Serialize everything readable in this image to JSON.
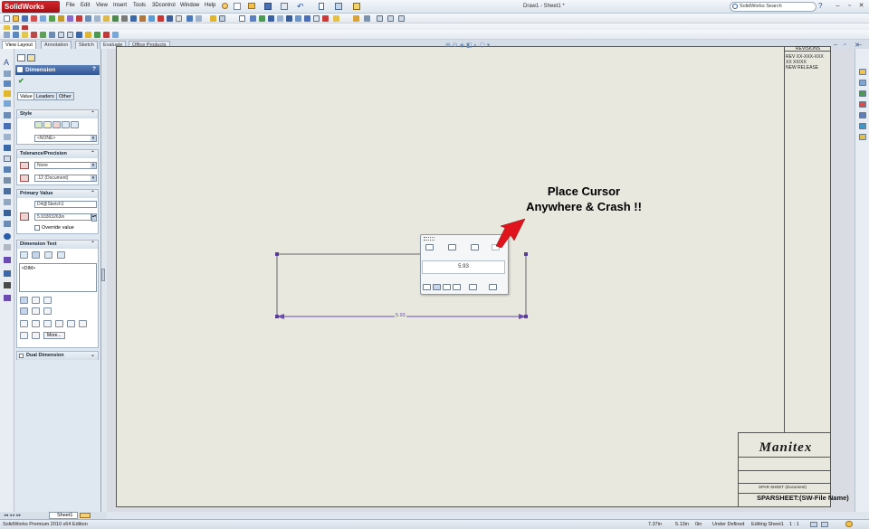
{
  "app": {
    "name": "SolidWorks",
    "document_title": "Draw1 - Sheet1 *",
    "menu": [
      "File",
      "Edit",
      "View",
      "Insert",
      "Tools",
      "3Dcontrol",
      "Window",
      "Help"
    ],
    "search_placeholder": "SolidWorks Search"
  },
  "tabs": [
    "View Layout",
    "Annotation",
    "Sketch",
    "Evaluate",
    "Office Products"
  ],
  "property_manager": {
    "title": "Dimension",
    "help": "?",
    "ok": "✔",
    "subtabs": [
      "Value",
      "Leaders",
      "Other"
    ],
    "style": {
      "header": "Style",
      "select": "<NONE>"
    },
    "tolerance": {
      "header": "Tolerance/Precision",
      "tolerance_type": "None",
      "precision": ".12 (Document)"
    },
    "primary_value": {
      "header": "Primary Value",
      "name": "D4@Sketch1",
      "value": "5.93303263in",
      "override_label": "Override value"
    },
    "dimension_text": {
      "header": "Dimension Text",
      "text": "<DIM>",
      "more_button": "More..."
    },
    "dual_dimension": {
      "header": "Dual Dimension"
    }
  },
  "drawing": {
    "dimension_label": "5.93",
    "palette_value": "5.93"
  },
  "annotation": {
    "line1": "Place Cursor",
    "line2": "Anywhere & Crash !!"
  },
  "title_block": {
    "revisions_header": "REVISIONS",
    "rev_lines": [
      "REV XX-XXX-XXX",
      "XX XX/XX",
      "NEW RELEASE"
    ],
    "company_logo": "Manitex",
    "sheet_small": "SPAR SHEET (Document)",
    "sheet_label": "SPARSHEET:(SW-File Name)"
  },
  "bottom_tabs": {
    "sheet": "Sheet1"
  },
  "status_bar": {
    "edition": "SolidWorks Premium 2010 x64 Edition",
    "x": "7.37in",
    "y": "5.13in",
    "z": "0in",
    "state": "Under Defined",
    "editing": "Editing Sheet1",
    "scale": "1 : 1"
  },
  "colors": {
    "accent": "#2a5faa",
    "sketch": "#6a4bb0",
    "arrow": "#e0141c",
    "sheet_bg": "#e9e8df"
  }
}
